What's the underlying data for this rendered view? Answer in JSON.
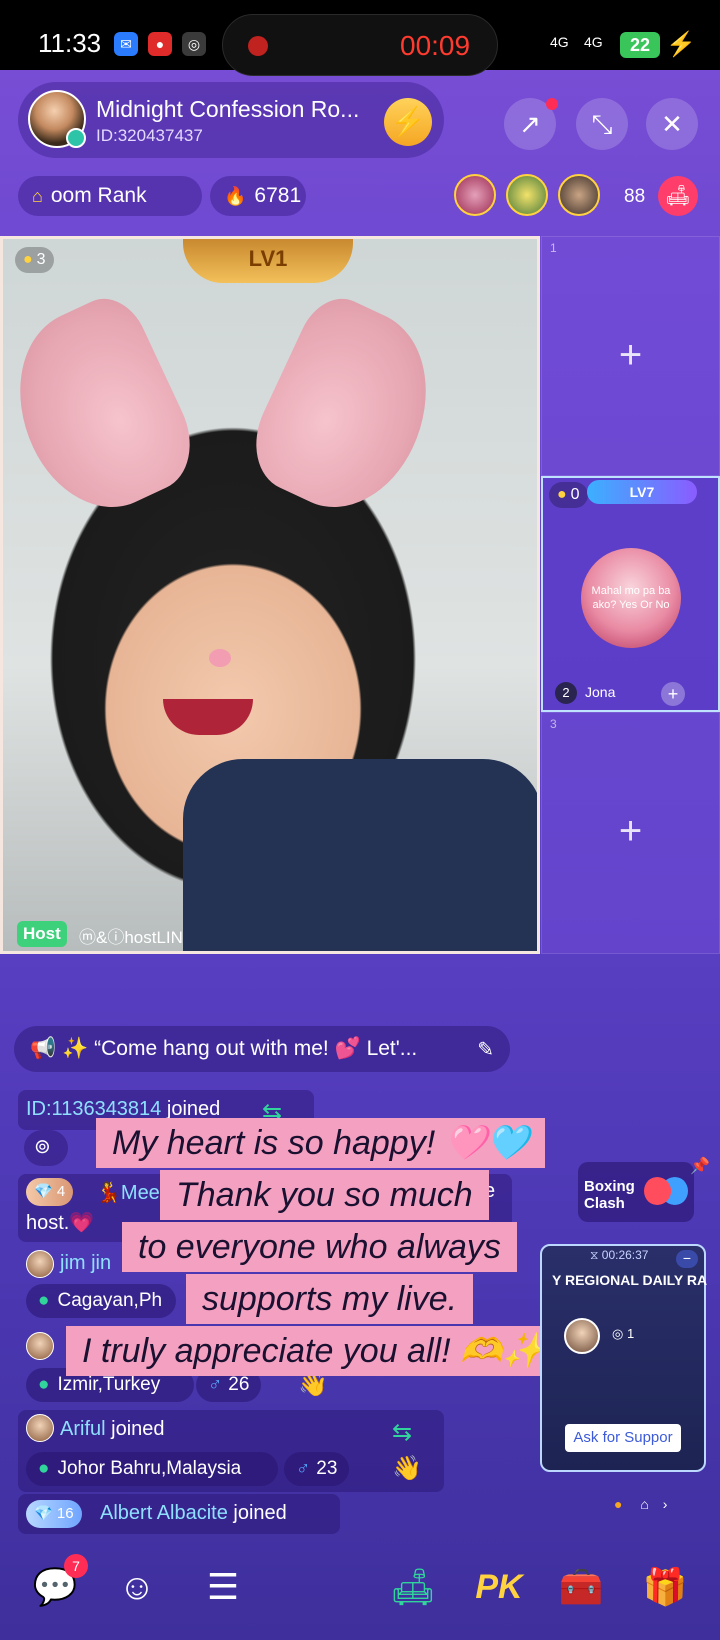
{
  "status_bar": {
    "time": "11:33",
    "record_time": "00:09",
    "network_1": "4G",
    "network_2": "4G",
    "battery": "22"
  },
  "room": {
    "title": "Midnight Confession Ro...",
    "id_label": "ID:320437437"
  },
  "room_rank_label": "oom Rank",
  "popularity": "6781",
  "viewer_count": "88",
  "host_video": {
    "coin_count": "3",
    "level": "LV1",
    "host_tag": "Host",
    "host_name": "ⓜ&ⓘhostLIN"
  },
  "seats": [
    {
      "number": "1"
    },
    {
      "number": "2",
      "coin_count": "0",
      "level": "LV7",
      "name": "Jona",
      "avatar_text": "Mahal mo pa ba ako? Yes Or No"
    },
    {
      "number": "3"
    }
  ],
  "announcement": "✨ “Come hang out with me! 💕 Let'...",
  "chat": {
    "join1_id": "ID:1136343814",
    "join1_text": "joined",
    "gift_level": "4",
    "gift_name": "💃Mee",
    "gift_tail": "e",
    "gift_line2": "host.💗",
    "jim_name": "jim jin",
    "jim_loc": "Cagayan,Ph",
    "izmir_loc": "Izmir,Turkey",
    "izmir_age": "26",
    "ariful_name": "Ariful",
    "ariful_text": "joined",
    "ariful_loc": "Johor Bahru,Malaysia",
    "ariful_age": "23",
    "albert_level": "16",
    "albert_name": "Albert Albacite",
    "albert_text": "joined"
  },
  "captions": [
    "My heart is so happy! 🩷🩵",
    "Thank you so much",
    "to everyone who always",
    "supports my live.",
    "I truly appreciate you all! 🫶✨"
  ],
  "boxing_clash": "Boxing\nClash",
  "daily_rank": {
    "timer": "00:26:37",
    "title": "Y REGIONAL DAILY RA",
    "rank_value": "1",
    "support_label": "Ask for Suppor"
  },
  "chat_badge": "7",
  "pk_label": "PK"
}
